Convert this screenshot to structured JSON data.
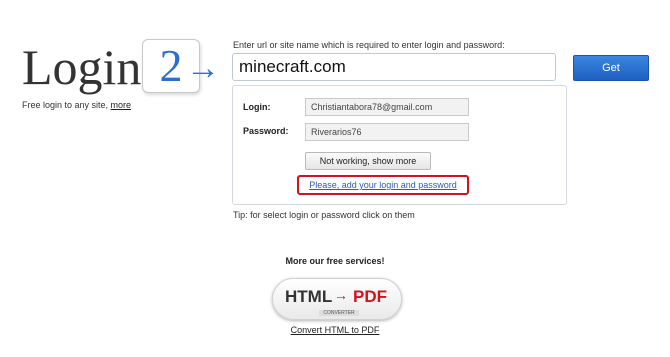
{
  "logo": {
    "word": "Login",
    "number": "2",
    "arrow": "→"
  },
  "tagline": {
    "text": "Free login to any site, ",
    "more_link": "more"
  },
  "url": {
    "label": "Enter url or site name which is required to enter login and password:",
    "value": "minecraft.com",
    "get_button": "Get"
  },
  "result": {
    "login_label": "Login:",
    "login_value": "Christiantabora78@gmail.com",
    "password_label": "Password:",
    "password_value": "Riverarios76",
    "not_working_button": "Not working, show more",
    "add_link": "Please, add your login and password"
  },
  "tip": "Tip: for select login or password click on them",
  "services": {
    "title": "More our free services!",
    "badge_html": "HTML",
    "badge_arrow": "→",
    "badge_pdf": "PDF",
    "badge_sub": "CONVERTER",
    "convert_link": "Convert HTML to PDF"
  },
  "colors": {
    "accent_blue": "#2b6fd3",
    "button_blue": "#1d5fc0",
    "highlight_red": "#d3121d"
  }
}
